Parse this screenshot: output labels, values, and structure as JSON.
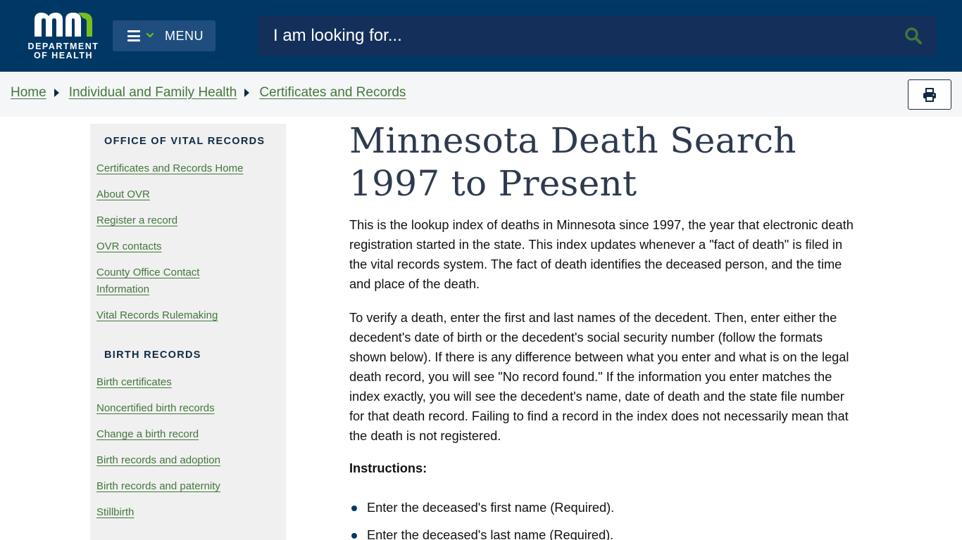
{
  "header": {
    "logo": {
      "mark": "mn",
      "line1": "DEPARTMENT",
      "line2": "OF HEALTH"
    },
    "menu_label": "MENU",
    "search_placeholder": "I am looking for...",
    "colors": {
      "background": "#003865",
      "logo_green": "#78be20",
      "search_icon": "#41793a"
    }
  },
  "breadcrumb": {
    "items": [
      {
        "label": "Home"
      },
      {
        "label": "Individual and Family Health"
      },
      {
        "label": "Certificates and Records"
      }
    ],
    "print_icon": "printer-icon"
  },
  "sidebar": {
    "sections": [
      {
        "heading": "OFFICE OF VITAL RECORDS",
        "links": [
          "Certificates and Records Home",
          "About OVR",
          "Register a record",
          "OVR contacts",
          "County Office Contact Information",
          "Vital Records Rulemaking"
        ]
      },
      {
        "heading": "BIRTH RECORDS",
        "links": [
          "Birth certificates",
          "Noncertified birth records",
          "Change a birth record",
          "Birth records and adoption",
          "Birth records and paternity",
          "Stillbirth"
        ]
      }
    ]
  },
  "main": {
    "title_line1": "Minnesota Death Search",
    "title_line2": "1997 to Present",
    "paragraph1": "This is the lookup index of deaths in Minnesota since 1997, the year that electronic death registration started in the state. This index updates whenever a \"fact of death\" is filed in the vital records system. The fact of death identifies the deceased person, and the time and place of the death.",
    "paragraph2": "To verify a death, enter the first and last names of the decedent. Then, enter either the decedent's date of birth or the decedent's social security number (follow the formats shown below). If there is any difference between what you enter and what is on the legal death record, you will see \"No record found.\" If the information you enter matches the index exactly, you will see the decedent's name, date of death and the state file number for that death record. Failing to find a record in the index does not necessarily mean that the death is not registered.",
    "instructions_heading": "Instructions:",
    "instructions": [
      "Enter the deceased's first name (Required).",
      "Enter the deceased's last name (Required)."
    ]
  }
}
